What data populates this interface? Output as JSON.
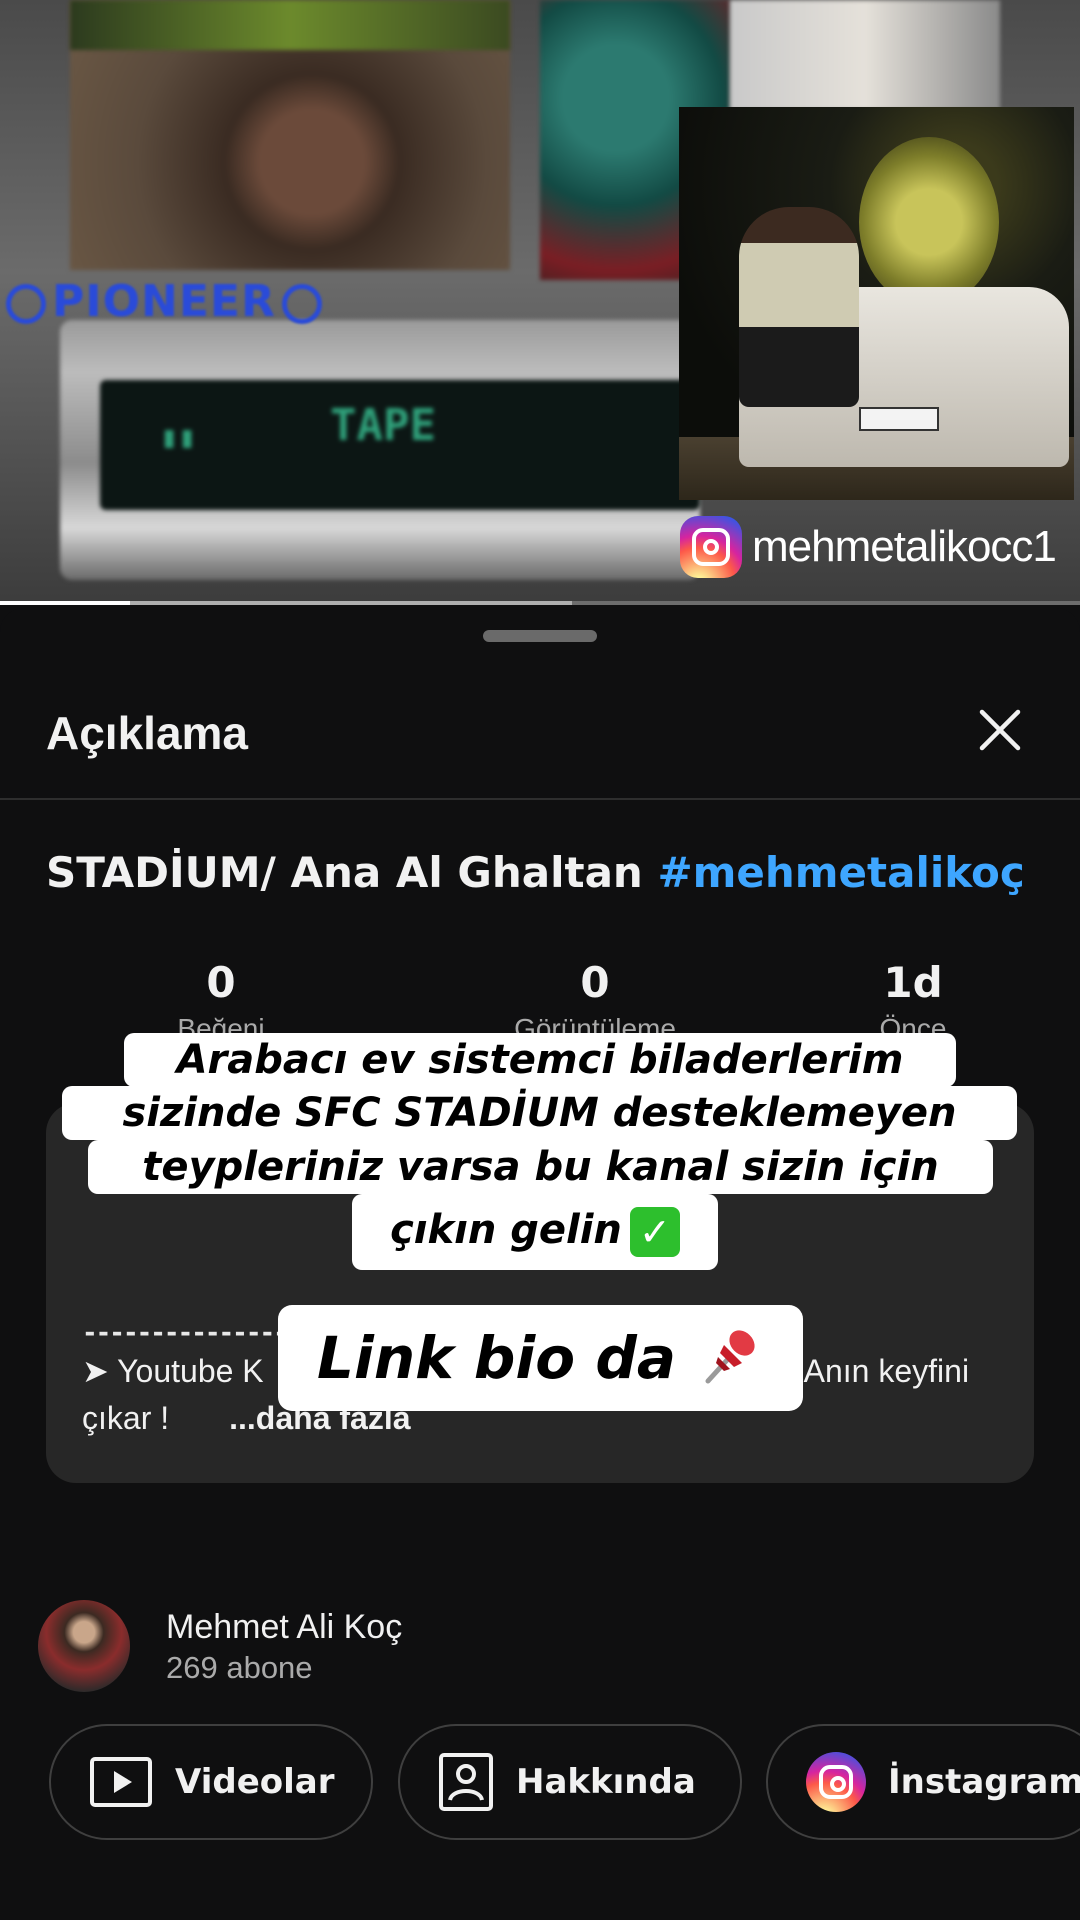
{
  "video": {
    "brand_text": "PIONEER",
    "display_text": "TAPE",
    "instagram_handle": "mehmetalikocc1",
    "progress_fraction": 0.12,
    "buffer_fraction": 0.53
  },
  "sheet": {
    "title": "Açıklama",
    "close_icon": "close-icon"
  },
  "video_info": {
    "title_main": "STADİUM/ Ana Al Ghaltan ",
    "title_hashtag": "#mehmetalikoç",
    "stats": [
      {
        "value": "0",
        "label": "Beğeni"
      },
      {
        "value": "0",
        "label": "Görüntüleme"
      },
      {
        "value": "1d",
        "label": "Önce"
      }
    ]
  },
  "description": {
    "dashes": "------------------------------",
    "text_start": "➤ Youtube K",
    "text_end": "Anın keyfini",
    "text_line2": "çıkar !",
    "more_label": "...daha fazla"
  },
  "overlay": {
    "caption_lines": [
      "Arabacı ev sistemci biladerlerim",
      "sizinde SFC STADİUM desteklemeyen",
      "teypleriniz varsa bu kanal sizin için",
      "çıkın gelin"
    ],
    "check_emoji": "✓",
    "link_text": "Link bio da"
  },
  "channel": {
    "name": "Mehmet Ali Koç",
    "subscribers": "269 abone"
  },
  "chips": [
    {
      "label": "Videolar",
      "icon": "play-icon"
    },
    {
      "label": "Hakkında",
      "icon": "person-icon"
    },
    {
      "label": "İnstagram",
      "icon": "instagram-icon"
    }
  ],
  "colors": {
    "background": "#0f0f10",
    "card": "#272727",
    "hashtag": "#3ea6ff",
    "text_secondary": "#aaaaaa"
  }
}
